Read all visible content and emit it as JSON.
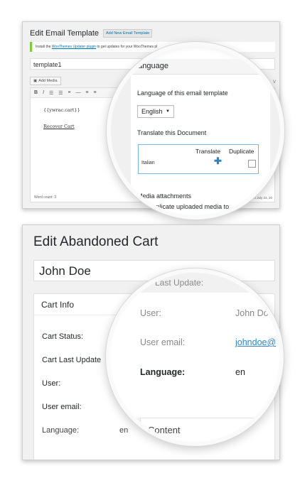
{
  "email_template": {
    "title": "Edit Email Template",
    "add_new_label": "Add New Email Template",
    "notice_prefix": "Install the",
    "notice_link": "WooThemes Updater plugin",
    "notice_suffix": "to get updates for your WooThemes pl",
    "template_name": "template1",
    "add_media_label": "Add Media",
    "toolbar": [
      "B",
      "I",
      "☰",
      "☰",
      "❝",
      "—",
      "≡",
      "≡"
    ],
    "editor_placeholder": "{{ywrac.cart}}",
    "recover_link": "Recover Cart",
    "word_count": "Word count: 3",
    "last_edited": "admin on July 23, 20",
    "side_letter": "V"
  },
  "language_box": {
    "heading": "Language",
    "language_label": "Language of this email template",
    "selected_language": "English",
    "translate_heading": "Translate this Document",
    "col_translate": "Translate",
    "col_duplicate": "Duplicate",
    "rows": [
      {
        "language": "Italian"
      }
    ],
    "media_heading": "Media attachments",
    "duplicate_media_label": "Duplicate uploaded media to"
  },
  "abandoned_cart": {
    "title": "Edit Abandoned Cart",
    "name": "John Doe",
    "box_title": "Cart Info",
    "labels": {
      "status": "Cart Status:",
      "last_update": "Cart Last Update",
      "user": "User:",
      "user_email": "User email:",
      "language": "Language:"
    },
    "language_value": "en"
  },
  "cart_zoom": {
    "last_update_label": "Last Update:",
    "user_label": "User:",
    "user_value": "John Do",
    "email_label": "User email:",
    "email_value": "johndoe@",
    "language_label": "Language:",
    "language_value": "en",
    "content_heading": "Content"
  },
  "colors": {
    "accent": "#2a87c6",
    "notice_border": "#7ad03a",
    "panel_bg": "#f1f1f1"
  }
}
